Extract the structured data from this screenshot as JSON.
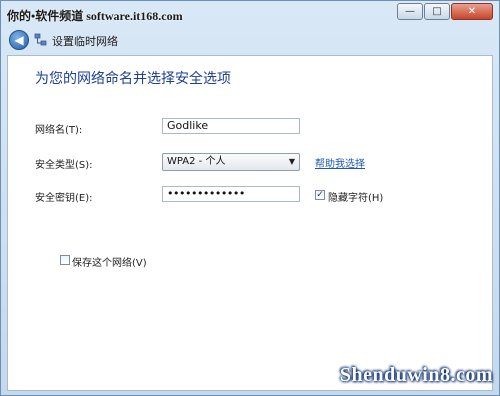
{
  "window": {
    "caption": "你的•软件频道 software.it168.com",
    "close_glyph": "✕",
    "min_glyph": "—",
    "max_glyph": "□"
  },
  "nav": {
    "back_glyph": "◀",
    "title": "设置临时网络"
  },
  "dialog": {
    "heading": "为您的网络命名并选择安全选项",
    "network_name_label": "网络名(T):",
    "network_name_value": "Godlike",
    "security_type_label": "安全类型(S):",
    "security_type_value": "WPA2 - 个人",
    "security_type_arrow": "▼",
    "help_link": "帮助我选择",
    "security_key_label": "安全密钥(E):",
    "security_key_value": "•••••••••••••",
    "hide_chars_label": "隐藏字符(H)",
    "hide_chars_checked": true,
    "hide_chars_glyph": "✓",
    "save_network_label": "保存这个网络(V)",
    "save_network_checked": false
  },
  "watermark": "Shenduwin8.com",
  "colors": {
    "heading": "#1c3f94",
    "link": "#1f57b5",
    "frame": "#c5d9ec"
  }
}
